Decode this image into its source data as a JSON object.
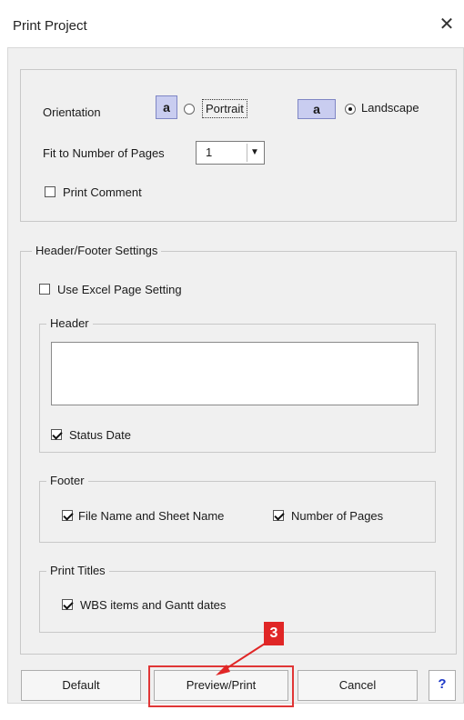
{
  "window": {
    "title": "Print Project",
    "close_icon": "close-icon",
    "close_glyph": "✕"
  },
  "orientation": {
    "label": "Orientation",
    "icon_glyph": "a",
    "portrait_label": "Portrait",
    "landscape_label": "Landscape",
    "selected": "Landscape"
  },
  "fit_pages": {
    "label": "Fit to Number of Pages",
    "value": "1"
  },
  "print_comment": {
    "label": "Print Comment",
    "checked": false
  },
  "header_footer": {
    "legend": "Header/Footer Settings",
    "use_excel": {
      "label": "Use Excel Page Setting",
      "checked": false
    },
    "header": {
      "legend": "Header",
      "text": "",
      "status_date": {
        "label": "Status Date",
        "checked": true
      }
    },
    "footer": {
      "legend": "Footer",
      "file_name": {
        "label": "File Name and Sheet Name",
        "checked": true
      },
      "num_pages": {
        "label": "Number of Pages",
        "checked": true
      }
    },
    "print_titles": {
      "legend": "Print Titles",
      "wbs": {
        "label": "WBS items and Gantt dates",
        "checked": true
      }
    }
  },
  "buttons": {
    "default": "Default",
    "preview": "Preview/Print",
    "cancel": "Cancel",
    "help": "?"
  },
  "annotation": {
    "step": "3",
    "color": "#e02626"
  }
}
